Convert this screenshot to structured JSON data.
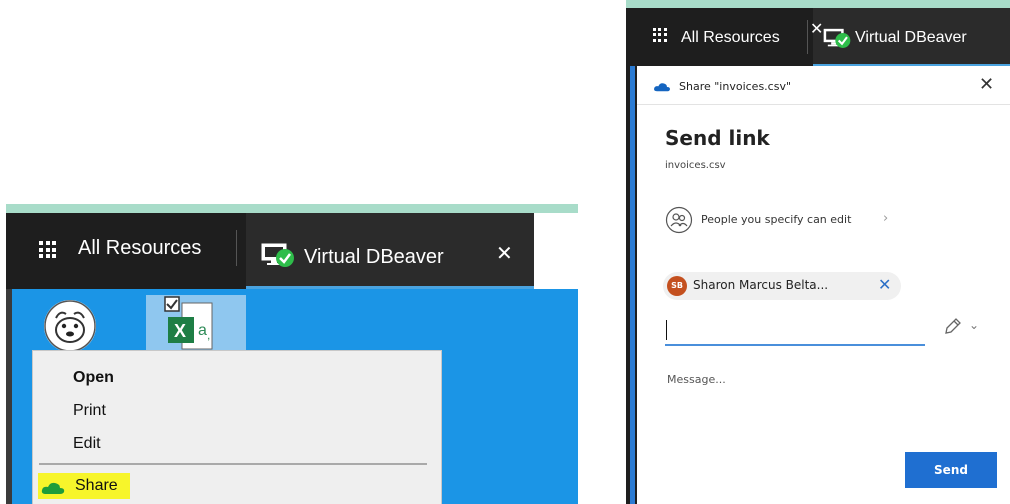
{
  "left_screen": {
    "tabs": {
      "all_resources": "All Resources",
      "virtual_dbeaver": "Virtual DBeaver",
      "close_symbol": "✕"
    },
    "desktop_icons": [
      "dbeaver-icon",
      "excel-csv-icon"
    ],
    "context_menu": {
      "items": [
        {
          "label": "Open",
          "bold": true
        },
        {
          "label": "Print"
        },
        {
          "label": "Edit"
        },
        {
          "label": "Share",
          "highlighted": true,
          "icon": "onedrive-cloud-icon"
        }
      ]
    }
  },
  "right_screen": {
    "tabs": {
      "all_resources": "All Resources",
      "virtual_dbeaver": "Virtual DBeaver",
      "close_symbol": "✕"
    },
    "dialog": {
      "header_title": "Share \"invoices.csv\"",
      "close_symbol": "✕",
      "heading": "Send link",
      "file_name": "invoices.csv",
      "permission": "People you specify can edit",
      "permission_chevron": "›",
      "recipient": {
        "initials": "SB",
        "name": "Sharon Marcus Belta...",
        "remove_symbol": "✕"
      },
      "to_value": "",
      "message_placeholder": "Message...",
      "send_label": "Send"
    }
  },
  "colors": {
    "tab_bar": "#1e1e1e",
    "active_tab_underline": "#4aa3df",
    "desktop_blue": "#1b95e6",
    "highlight_yellow": "#f7f52b",
    "send_blue": "#1f6fd1",
    "avatar_orange": "#c4501f"
  }
}
